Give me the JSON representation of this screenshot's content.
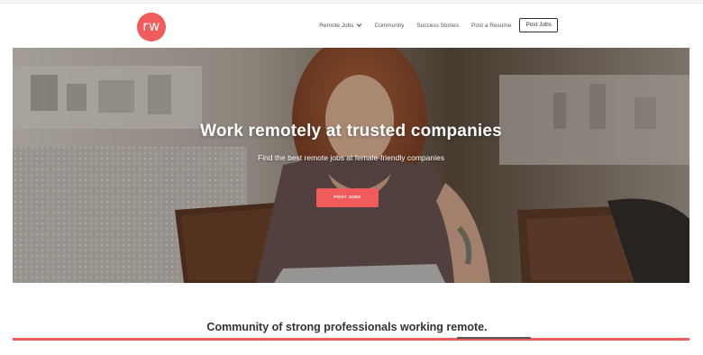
{
  "header": {
    "logo_text": "rw",
    "nav": {
      "remote_jobs": "Remote Jobs",
      "community": "Community",
      "success_stories": "Success Stories",
      "post_resume": "Post a Resume",
      "post_jobs": "Post Jobs"
    }
  },
  "hero": {
    "title": "Work remotely at trusted companies",
    "subtitle": "Find the best remote jobs at female-friendly companies",
    "cta": "POST JOBS"
  },
  "community": {
    "heading": "Community of strong professionals working remote."
  },
  "colors": {
    "brand": "#f15b5b",
    "text": "#333333"
  },
  "icons": {
    "dropdown": "chevron-down-icon"
  }
}
